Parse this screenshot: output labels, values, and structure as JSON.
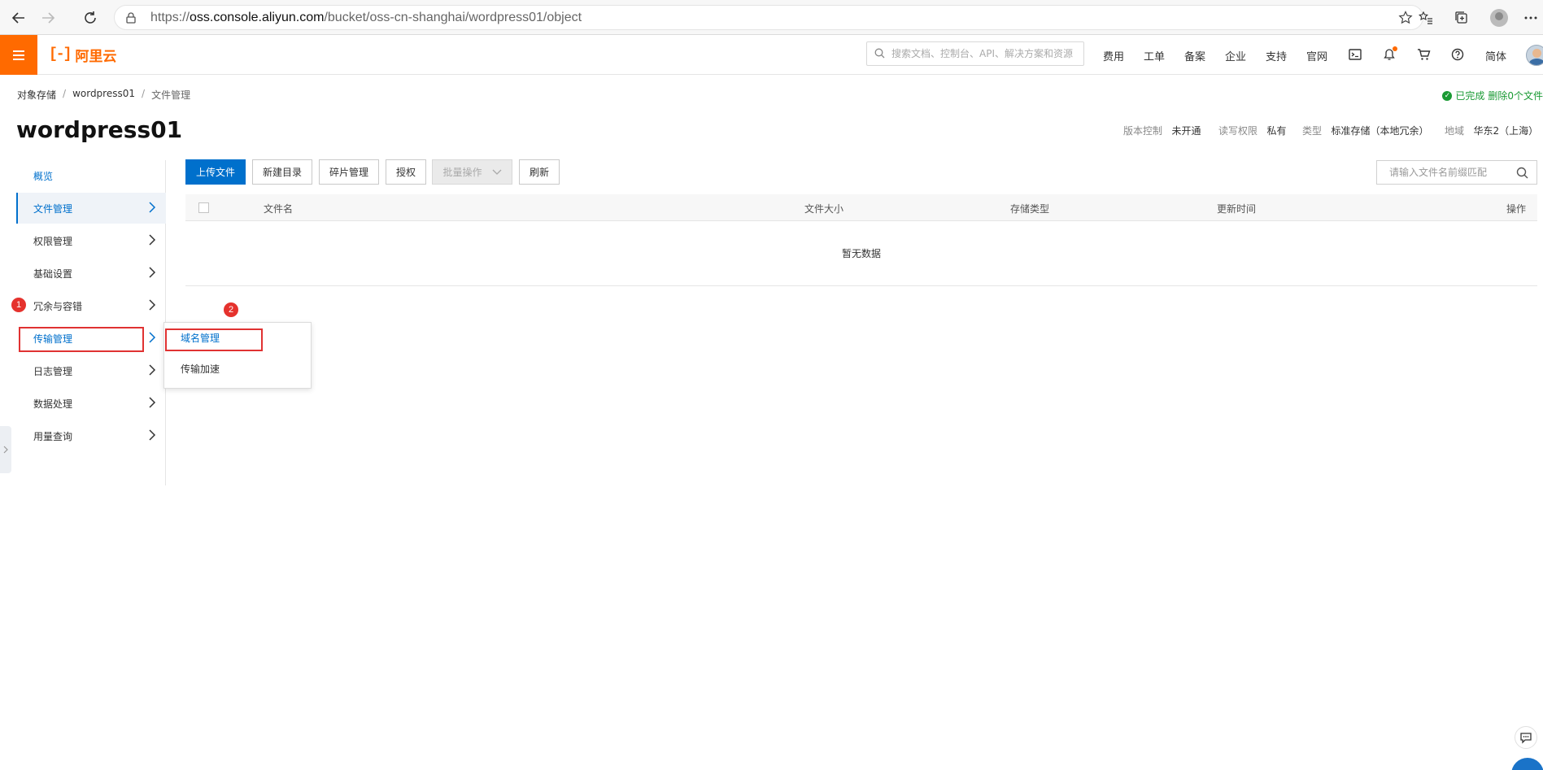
{
  "browser": {
    "url_scheme": "https://",
    "url_host": "oss.console.aliyun.com",
    "url_path": "/bucket/oss-cn-shanghai/wordpress01/object"
  },
  "topnav": {
    "logo_mark": "[-]",
    "logo_text": "阿里云",
    "search_placeholder": "搜索文档、控制台、API、解决方案和资源",
    "items": [
      "费用",
      "工单",
      "备案",
      "企业",
      "支持",
      "官网"
    ],
    "lang": "简体",
    "accent_color": "#ff6a00"
  },
  "breadcrumb": {
    "root": "对象存储",
    "bucket": "wordpress01",
    "current": "文件管理",
    "sep": "/"
  },
  "status": {
    "done": "已完成",
    "deleted": "删除0个文件"
  },
  "header": {
    "title": "wordpress01",
    "meta": [
      {
        "key": "版本控制",
        "value": "未开通"
      },
      {
        "key": "读写权限",
        "value": "私有"
      },
      {
        "key": "类型",
        "value": "标准存储（本地冗余）"
      },
      {
        "key": "地域",
        "value": "华东2（上海）"
      }
    ]
  },
  "sidebar": {
    "items": [
      {
        "label": "概览"
      },
      {
        "label": "文件管理"
      },
      {
        "label": "权限管理"
      },
      {
        "label": "基础设置"
      },
      {
        "label": "冗余与容错"
      },
      {
        "label": "传输管理"
      },
      {
        "label": "日志管理"
      },
      {
        "label": "数据处理"
      },
      {
        "label": "用量查询"
      }
    ]
  },
  "submenu": {
    "items": [
      {
        "label": "域名管理"
      },
      {
        "label": "传输加速"
      }
    ]
  },
  "annotations": {
    "step1": "1",
    "step2": "2",
    "box_color": "#e03232"
  },
  "toolbar": {
    "upload": "上传文件",
    "new_dir": "新建目录",
    "fragments": "碎片管理",
    "authorize": "授权",
    "batch": "批量操作",
    "refresh": "刷新",
    "search_placeholder": "请输入文件名前缀匹配"
  },
  "table": {
    "columns": [
      "文件名",
      "文件大小",
      "存储类型",
      "更新时间",
      "操作"
    ],
    "empty": "暂无数据"
  }
}
